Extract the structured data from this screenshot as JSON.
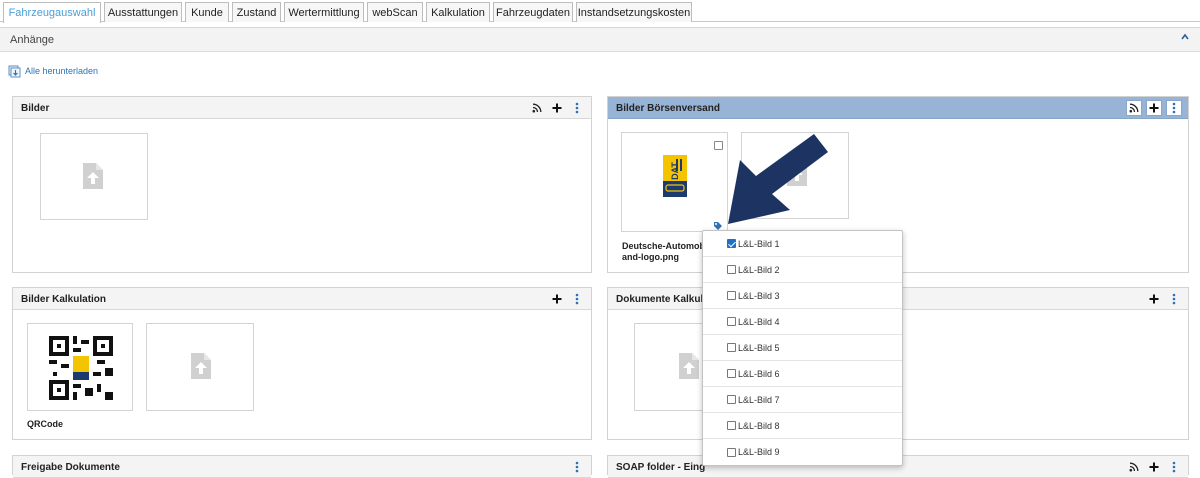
{
  "tabs": [
    {
      "label": "Fahrzeugauswahl",
      "active": true
    },
    {
      "label": "Ausstattungen",
      "active": false
    },
    {
      "label": "Kunde",
      "active": false
    },
    {
      "label": "Zustand",
      "active": false
    },
    {
      "label": "Wertermittlung",
      "active": false
    },
    {
      "label": "webScan",
      "active": false
    },
    {
      "label": "Kalkulation",
      "active": false
    },
    {
      "label": "Fahrzeugdaten",
      "active": false
    },
    {
      "label": "Instandsetzungskosten",
      "active": false
    }
  ],
  "panel": {
    "title": "Anhänge",
    "download_all": "Alle herunterladen"
  },
  "sections": {
    "bilder": {
      "title": "Bilder"
    },
    "boersenversand": {
      "title": "Bilder Börsenversand",
      "tile_caption_line1": "Deutsche-Automobil",
      "tile_caption_line2": "and-logo.png"
    },
    "kalkulation": {
      "title": "Bilder Kalkulation",
      "tile_caption": "QRCode"
    },
    "dokumente_kalkulation": {
      "title": "Dokumente Kalkul"
    },
    "freigabe": {
      "title": "Freigabe Dokumente"
    },
    "soap": {
      "title": "SOAP folder - Eing"
    }
  },
  "dropdown": {
    "items": [
      {
        "label": "L&L-Bild 1",
        "checked": true
      },
      {
        "label": "L&L-Bild 2",
        "checked": false
      },
      {
        "label": "L&L-Bild 3",
        "checked": false
      },
      {
        "label": "L&L-Bild 4",
        "checked": false
      },
      {
        "label": "L&L-Bild 5",
        "checked": false
      },
      {
        "label": "L&L-Bild 6",
        "checked": false
      },
      {
        "label": "L&L-Bild 7",
        "checked": false
      },
      {
        "label": "L&L-Bild 8",
        "checked": false
      },
      {
        "label": "L&L-Bild 9",
        "checked": false
      }
    ]
  },
  "logo_text": "DAT",
  "colors": {
    "active_tab_text": "#4a9fd8",
    "blue_header": "#97b4d6",
    "link": "#2e74b5",
    "arrow": "#1d3463",
    "logo_yellow": "#f5c400",
    "logo_blue": "#1d3a6e",
    "checkbox_checked": "#1f6fc5"
  }
}
